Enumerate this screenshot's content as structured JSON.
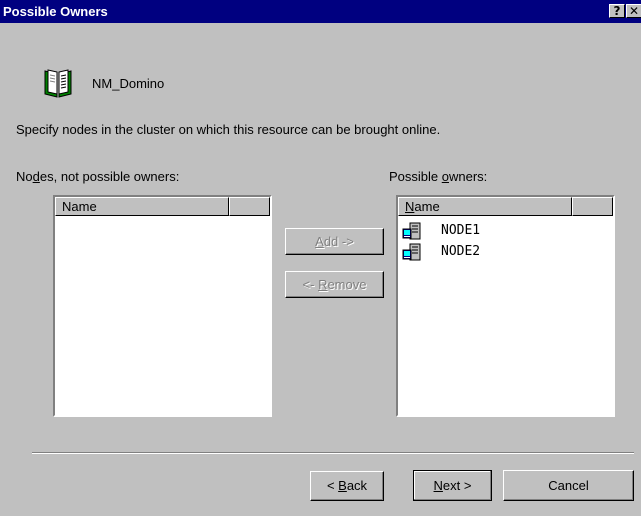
{
  "window": {
    "title": "Possible Owners",
    "help_button": "?",
    "close_button": "✕"
  },
  "resource": {
    "icon": "book-icon",
    "name": "NM_Domino"
  },
  "instruction": "Specify nodes in the cluster on which this resource can be brought online.",
  "left_list": {
    "label_pre": "No",
    "label_mnemonic": "d",
    "label_post": "es, not possible owners:",
    "column_name": "Name",
    "column_extra": "",
    "items": []
  },
  "right_list": {
    "label_pre": "Possible ",
    "label_mnemonic": "o",
    "label_post": "wners:",
    "column_name_mnemonic": "N",
    "column_name_rest": "ame",
    "column_extra": "",
    "items": [
      {
        "label": "NODE1",
        "icon": "server-node-icon"
      },
      {
        "label": "NODE2",
        "icon": "server-node-icon"
      }
    ]
  },
  "buttons": {
    "add_mnemonic": "A",
    "add_rest": "dd ->",
    "remove_pre": "<- ",
    "remove_mnemonic": "R",
    "remove_rest": "emove",
    "back_pre": "< ",
    "back_mnemonic": "B",
    "back_rest": "ack",
    "next_mnemonic": "N",
    "next_rest": "ext >",
    "cancel": "Cancel"
  },
  "colors": {
    "titlebar": "#000080",
    "face": "#c0c0c0",
    "disabled_text": "#808080"
  }
}
